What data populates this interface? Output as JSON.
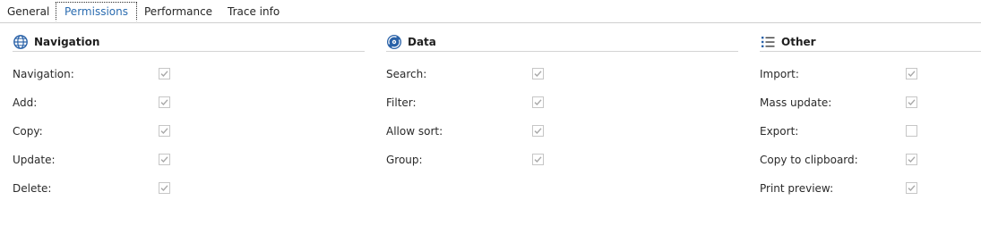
{
  "tabs": [
    {
      "label": "General",
      "active": false
    },
    {
      "label": "Permissions",
      "active": true
    },
    {
      "label": "Performance",
      "active": false
    },
    {
      "label": "Trace info",
      "active": false
    }
  ],
  "sections": {
    "navigation": {
      "title": "Navigation",
      "icon": "globe-icon",
      "rows": [
        {
          "label": "Navigation:",
          "checked": true
        },
        {
          "label": "Add:",
          "checked": true
        },
        {
          "label": "Copy:",
          "checked": true
        },
        {
          "label": "Update:",
          "checked": true
        },
        {
          "label": "Delete:",
          "checked": true
        }
      ]
    },
    "data": {
      "title": "Data",
      "icon": "database-disc-icon",
      "rows": [
        {
          "label": "Search:",
          "checked": true
        },
        {
          "label": "Filter:",
          "checked": true
        },
        {
          "label": "Allow sort:",
          "checked": true
        },
        {
          "label": "Group:",
          "checked": true
        }
      ]
    },
    "other": {
      "title": "Other",
      "icon": "list-icon",
      "rows": [
        {
          "label": "Import:",
          "checked": true
        },
        {
          "label": "Mass update:",
          "checked": true
        },
        {
          "label": "Export:",
          "checked": false
        },
        {
          "label": "Copy to clipboard:",
          "checked": true
        },
        {
          "label": "Print preview:",
          "checked": true
        }
      ]
    }
  },
  "colors": {
    "accent": "#2b6cb0",
    "icon_blue": "#2a62a8",
    "checkmark": "#a8a8a8",
    "checkbox_border": "#c6c6c6"
  }
}
